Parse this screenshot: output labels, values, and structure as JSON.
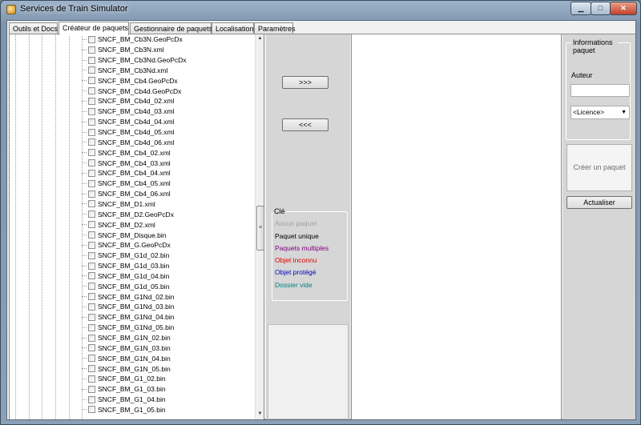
{
  "window": {
    "title": "Services de Train Simulator",
    "controls": {
      "minimize": "▁",
      "maximize": "□",
      "close": "✕"
    }
  },
  "tabs": [
    {
      "label": "Outils et Docs",
      "active": false
    },
    {
      "label": "Créateur de paquets",
      "active": true
    },
    {
      "label": "Gestionnaire de paquets",
      "active": false
    },
    {
      "label": "Localisation",
      "active": false
    },
    {
      "label": "Paramètres",
      "active": false
    }
  ],
  "tree": {
    "items": [
      "SNCF_BM_Cb3N.GeoPcDx",
      "SNCF_BM_Cb3N.xml",
      "SNCF_BM_Cb3Nd.GeoPcDx",
      "SNCF_BM_Cb3Nd.xml",
      "SNCF_BM_Cb4.GeoPcDx",
      "SNCF_BM_Cb4d.GeoPcDx",
      "SNCF_BM_Cb4d_02.xml",
      "SNCF_BM_Cb4d_03.xml",
      "SNCF_BM_Cb4d_04.xml",
      "SNCF_BM_Cb4d_05.xml",
      "SNCF_BM_Cb4d_06.xml",
      "SNCF_BM_Cb4_02.xml",
      "SNCF_BM_Cb4_03.xml",
      "SNCF_BM_Cb4_04.xml",
      "SNCF_BM_Cb4_05.xml",
      "SNCF_BM_Cb4_06.xml",
      "SNCF_BM_D1.xml",
      "SNCF_BM_D2.GeoPcDx",
      "SNCF_BM_D2.xml",
      "SNCF_BM_Disque.bin",
      "SNCF_BM_G.GeoPcDx",
      "SNCF_BM_G1d_02.bin",
      "SNCF_BM_G1d_03.bin",
      "SNCF_BM_G1d_04.bin",
      "SNCF_BM_G1d_05.bin",
      "SNCF_BM_G1Nd_02.bin",
      "SNCF_BM_G1Nd_03.bin",
      "SNCF_BM_G1Nd_04.bin",
      "SNCF_BM_G1Nd_05.bin",
      "SNCF_BM_G1N_02.bin",
      "SNCF_BM_G1N_03.bin",
      "SNCF_BM_G1N_04.bin",
      "SNCF_BM_G1N_05.bin",
      "SNCF_BM_G1_02.bin",
      "SNCF_BM_G1_03.bin",
      "SNCF_BM_G1_04.bin",
      "SNCF_BM_G1_05.bin"
    ]
  },
  "middle": {
    "add_label": ">>>",
    "remove_label": "<<<",
    "legend": {
      "title": "Clé",
      "items": [
        {
          "label": "Aucun paquet",
          "color": "#a0a0a0"
        },
        {
          "label": "Paquet unique",
          "color": "#000000"
        },
        {
          "label": "Paquets multiples",
          "color": "#800080"
        },
        {
          "label": "Objet inconnu",
          "color": "#e00000"
        },
        {
          "label": "Objet protégé",
          "color": "#0000c0"
        },
        {
          "label": "Dossier vide",
          "color": "#008080"
        }
      ]
    }
  },
  "info": {
    "group_title": "Informations paquet",
    "author_label": "Auteur",
    "author_value": "",
    "licence_selected": "<Licence>",
    "create_label": "Créer un paquet",
    "refresh_label": "Actualiser"
  }
}
